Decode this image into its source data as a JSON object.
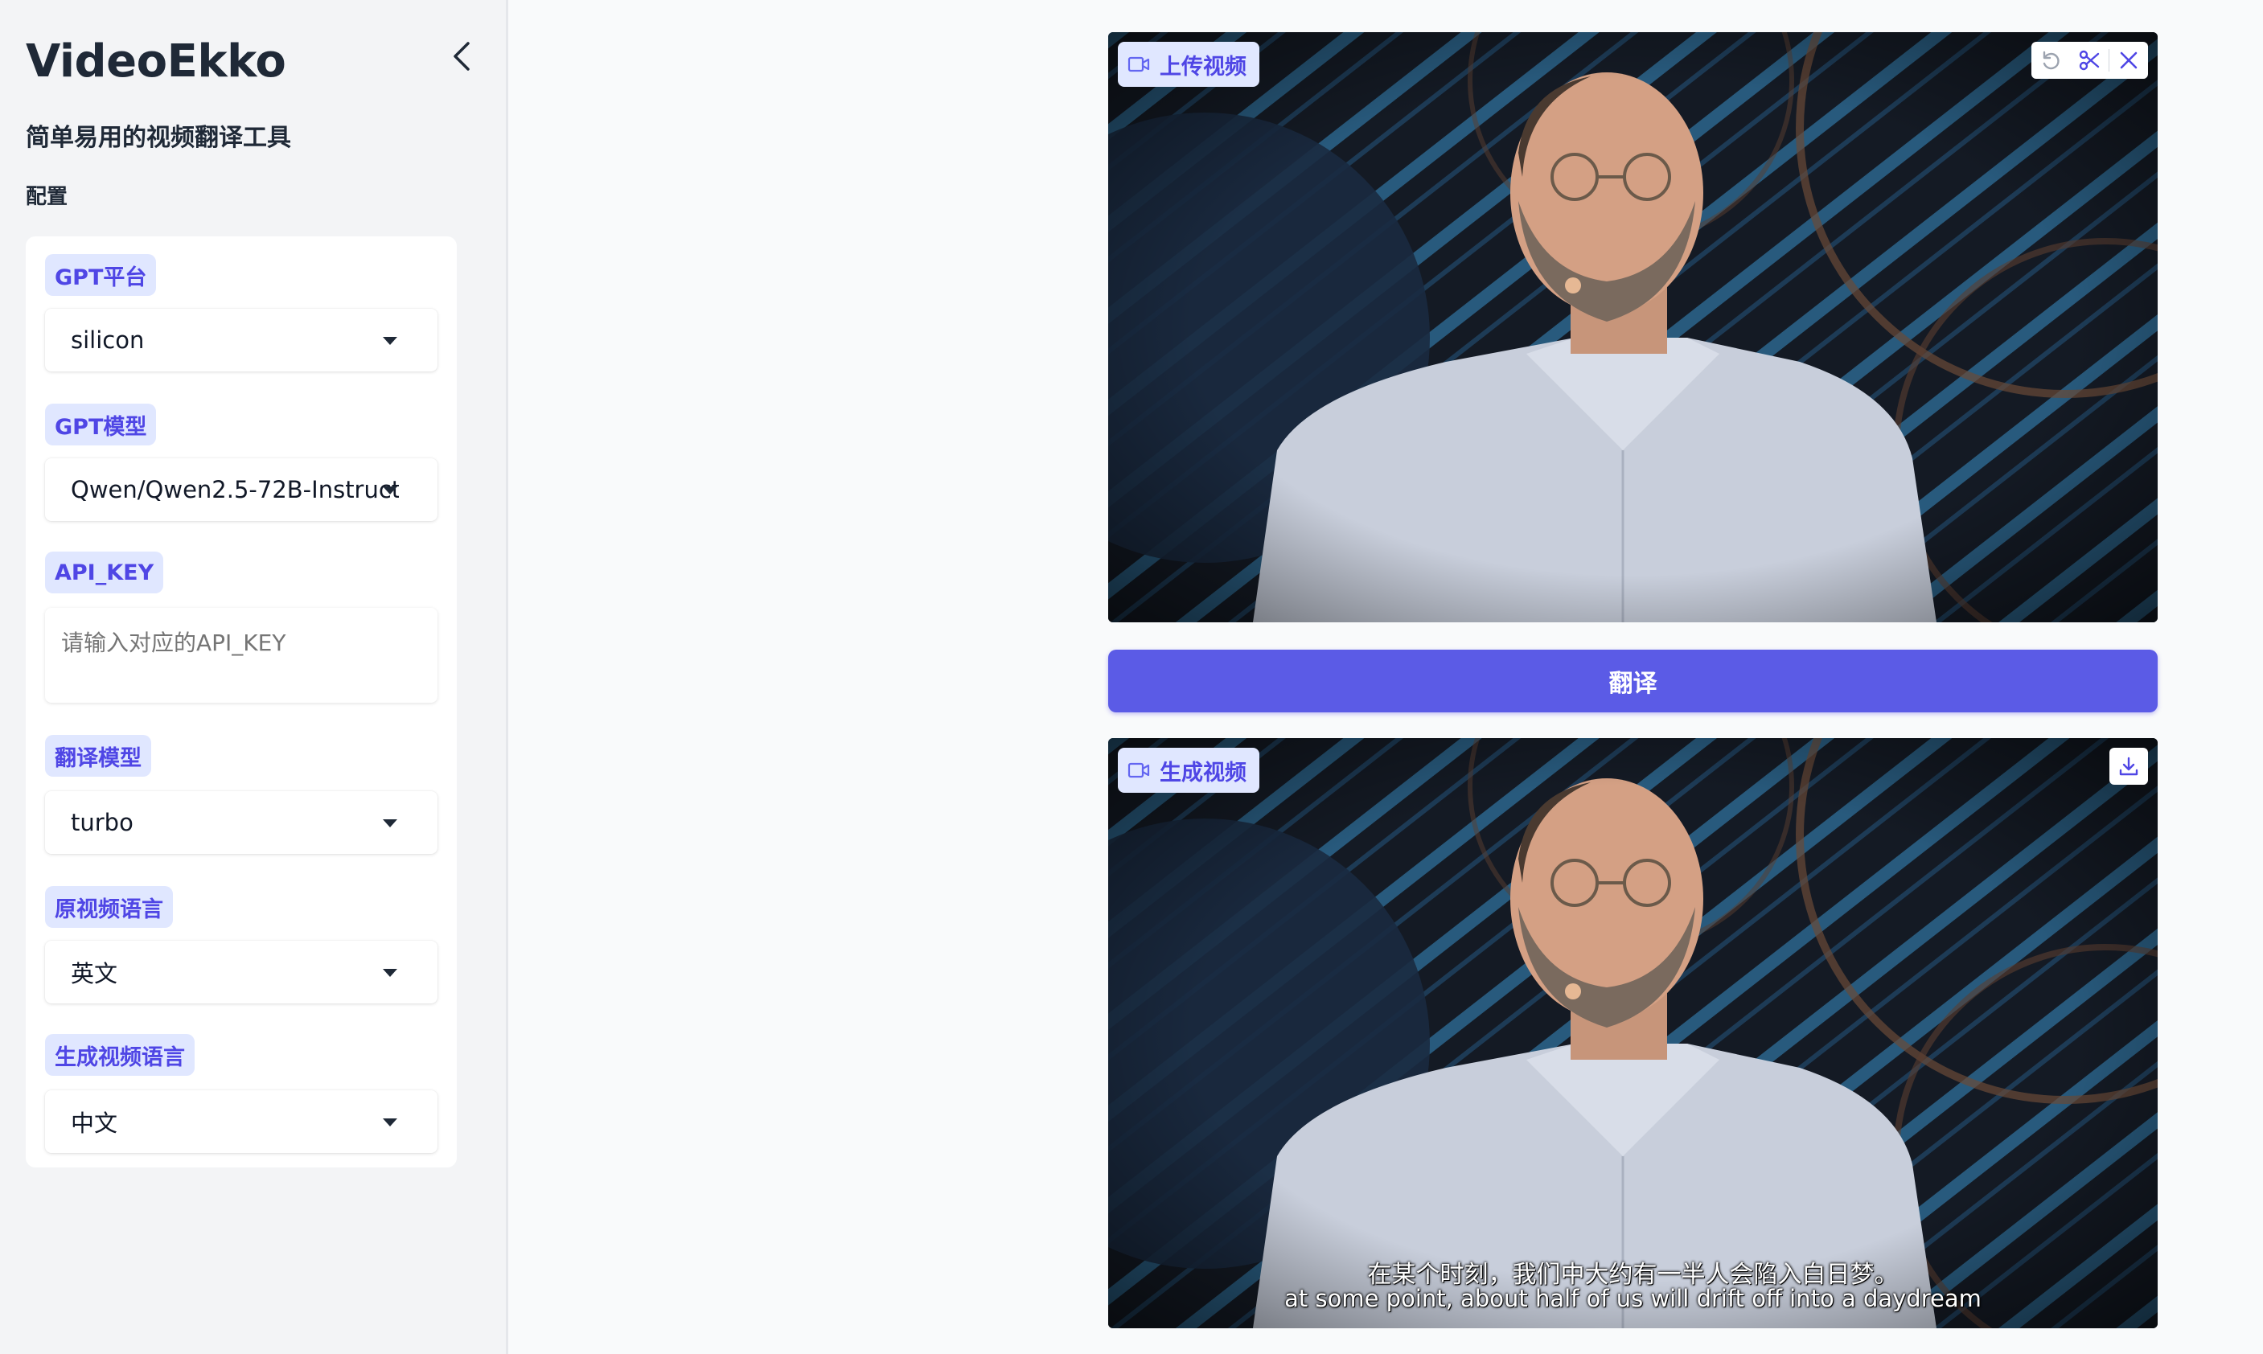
{
  "sidebar": {
    "title": "VideoEkko",
    "subtitle": "简单易用的视频翻译工具",
    "section_label": "配置",
    "fields": {
      "gpt_platform": {
        "label": "GPT平台",
        "value": "silicon"
      },
      "gpt_model": {
        "label": "GPT模型",
        "value": "Qwen/Qwen2.5-72B-Instruct"
      },
      "api_key": {
        "label": "API_KEY",
        "value": "",
        "placeholder": "请输入对应的API_KEY"
      },
      "translation_model": {
        "label": "翻译模型",
        "value": "turbo"
      },
      "source_language": {
        "label": "原视频语言",
        "value": "英文"
      },
      "target_language": {
        "label": "生成视频语言",
        "value": "中文"
      }
    }
  },
  "main": {
    "upload_video": {
      "label": "上传视频"
    },
    "translate_button": "翻译",
    "generated_video": {
      "label": "生成视频",
      "subtitle_zh": "在某个时刻，我们中大约有一半人会陷入白日梦。",
      "subtitle_en": "at some point, about half of us will drift off into a daydream"
    }
  },
  "colors": {
    "accent": "#5b5be6",
    "badge_bg": "#e0e7ff",
    "badge_text": "#4f46e5"
  }
}
